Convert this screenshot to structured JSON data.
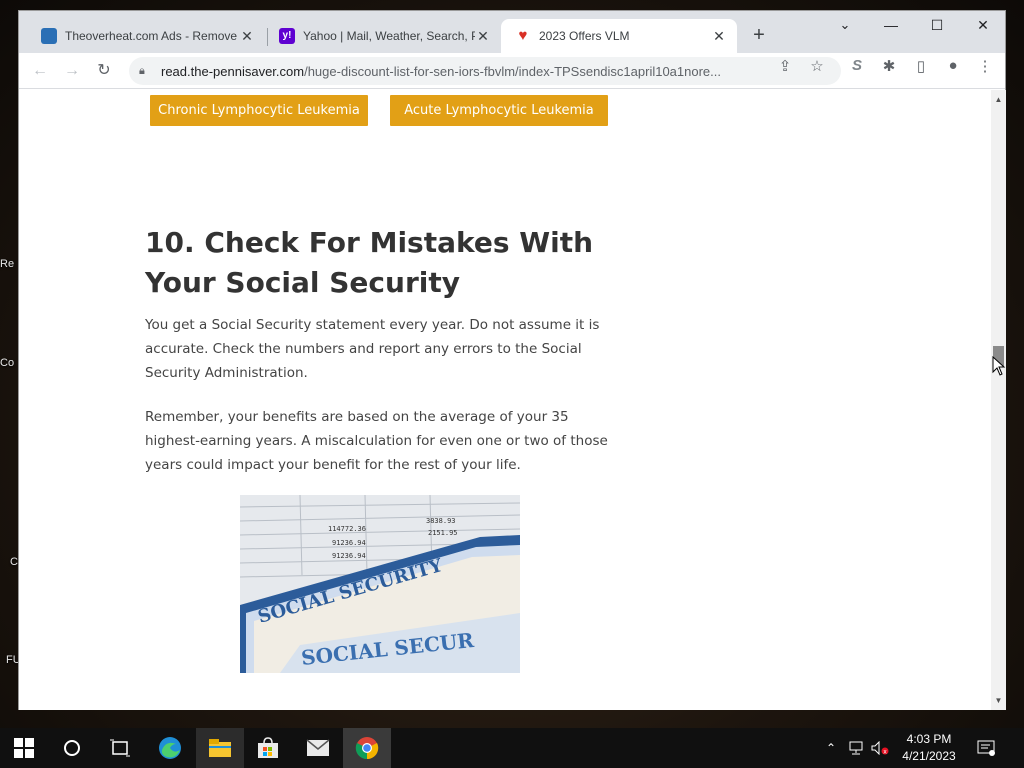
{
  "desktop": {
    "labels": [
      "Re",
      "Co",
      "C",
      "FU"
    ]
  },
  "tabs": [
    {
      "title": "Theoverheat.com Ads - Remove",
      "favicon_color": "#2a6fb5",
      "active": false
    },
    {
      "title": "Yahoo | Mail, Weather, Search, P",
      "favicon_color": "#5f01d1",
      "active": false
    },
    {
      "title": "2023 Offers VLM",
      "favicon_color": "#d93025",
      "active": true
    }
  ],
  "window": {
    "minimize": "—",
    "maximize": "☐",
    "close": "✕",
    "tab_search": "⌄",
    "new_tab": "+"
  },
  "toolbar": {
    "url_host": "read.the-pennisaver.com",
    "url_path": "/huge-discount-list-for-sen-iors-fbvlm/index-TPSsendisc1april10a1nore..."
  },
  "page": {
    "buttons": [
      "Chronic Lymphocytic Leukemia",
      "Acute Lymphocytic Leukemia"
    ],
    "accent": "#e2a016",
    "heading": "10. Check For Mistakes With Your Social Security",
    "paragraphs": [
      "You get a Social Security statement every year. Do not assume it is accurate. Check the numbers and report any errors to the Social Security Administration.",
      "Remember, your benefits are based on the average of your 35 highest-earning years. A miscalculation for even one or two of those years could impact your benefit for the rest of your life."
    ],
    "image": {
      "card_text_1": "SOCIAL SECURITY",
      "card_text_2": "SOCIAL SECUR",
      "form_numbers": [
        "114772.36",
        "91236.94",
        "91236.94",
        "3838.93",
        "2151.95"
      ]
    }
  },
  "taskbar": {
    "apps": [
      "windows-start",
      "cortana",
      "task-view",
      "edge",
      "file-explorer",
      "store",
      "mail",
      "chrome"
    ],
    "time": "4:03 PM",
    "date": "4/21/2023"
  }
}
